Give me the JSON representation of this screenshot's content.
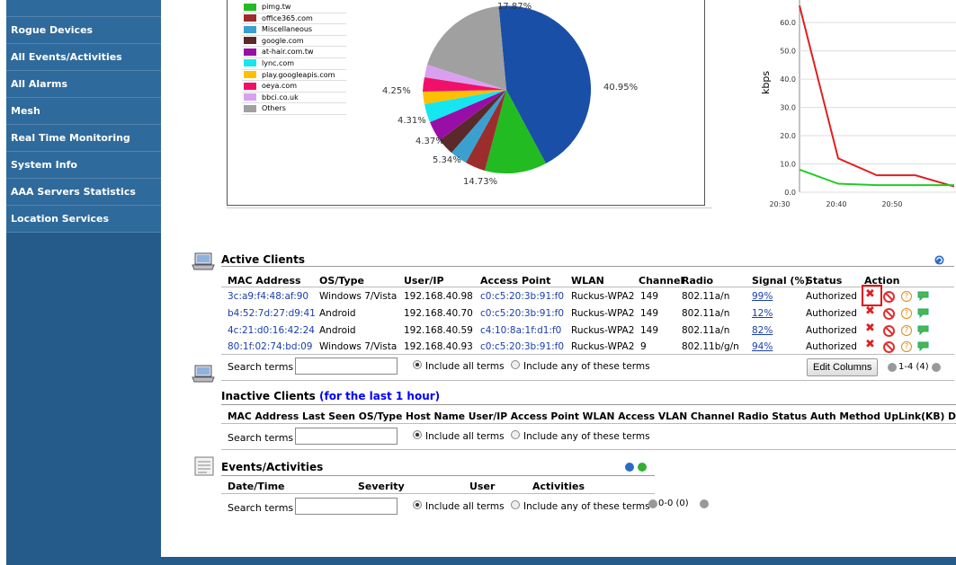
{
  "sidebar": {
    "items": [
      {
        "label": "Rogue Devices"
      },
      {
        "label": "All Events/Activities"
      },
      {
        "label": "All Alarms"
      },
      {
        "label": "Mesh"
      },
      {
        "label": "Real Time Monitoring"
      },
      {
        "label": "System Info"
      },
      {
        "label": "AAA Servers Statistics"
      },
      {
        "label": "Location Services"
      }
    ]
  },
  "pie": {
    "legend": [
      {
        "label": "pimg.tw",
        "color": "#22bb22"
      },
      {
        "label": "office365.com",
        "color": "#9b2d2d"
      },
      {
        "label": "Miscellaneous",
        "color": "#3aa0d0"
      },
      {
        "label": "google.com",
        "color": "#5a2a2a"
      },
      {
        "label": "at-hair.com.tw",
        "color": "#9a0ea8"
      },
      {
        "label": "lync.com",
        "color": "#15e6f0"
      },
      {
        "label": "play.googleapis.com",
        "color": "#ffc000"
      },
      {
        "label": "oeya.com",
        "color": "#f0106a"
      },
      {
        "label": "bbci.co.uk",
        "color": "#d9a0f0"
      },
      {
        "label": "Others",
        "color": "#a0a0a0"
      }
    ],
    "labels": {
      "top": "17.87%",
      "big": "40.95%",
      "green": "14.73%",
      "p534": "5.34%",
      "p437": "4.37%",
      "p431": "4.31%",
      "p425": "4.25%"
    }
  },
  "chart_data": {
    "type": "line",
    "ylabel": "kbps",
    "x": [
      "20:30",
      "20:40",
      "20:50"
    ],
    "yticks": [
      "0.0",
      "10.0",
      "20.0",
      "30.0",
      "40.0",
      "50.0",
      "60.0"
    ],
    "series": [
      {
        "color": "#e02020",
        "points": [
          [
            0,
            66
          ],
          [
            1,
            12
          ],
          [
            2,
            6
          ],
          [
            3,
            6
          ],
          [
            4,
            2
          ]
        ]
      },
      {
        "color": "#22cc22",
        "points": [
          [
            0,
            8
          ],
          [
            1,
            3
          ],
          [
            2,
            2.5
          ],
          [
            3,
            2.5
          ],
          [
            4,
            2.5
          ]
        ]
      }
    ]
  },
  "active": {
    "title": "Active Clients",
    "headers": [
      "MAC Address",
      "OS/Type",
      "User/IP",
      "Access Point",
      "WLAN",
      "Channel",
      "Radio",
      "Signal (%)",
      "Status",
      "Action"
    ],
    "rows": [
      {
        "mac": "3c:a9:f4:48:af:90",
        "os": "Windows 7/Vista",
        "ip": "192.168.40.98",
        "ap": "c0:c5:20:3b:91:f0",
        "wlan": "Ruckus-WPA2",
        "channel": "149",
        "radio": "802.11a/n",
        "signal": "99%",
        "status": "Authorized"
      },
      {
        "mac": "b4:52:7d:27:d9:41",
        "os": "Android",
        "ip": "192.168.40.70",
        "ap": "c0:c5:20:3b:91:f0",
        "wlan": "Ruckus-WPA2",
        "channel": "149",
        "radio": "802.11a/n",
        "signal": "12%",
        "status": "Authorized"
      },
      {
        "mac": "4c:21:d0:16:42:24",
        "os": "Android",
        "ip": "192.168.40.59",
        "ap": "c4:10:8a:1f:d1:f0",
        "wlan": "Ruckus-WPA2",
        "channel": "149",
        "radio": "802.11a/n",
        "signal": "82%",
        "status": "Authorized"
      },
      {
        "mac": "80:1f:02:74:bd:09",
        "os": "Windows 7/Vista",
        "ip": "192.168.40.93",
        "ap": "c0:c5:20:3b:91:f0",
        "wlan": "Ruckus-WPA2",
        "channel": "9",
        "radio": "802.11b/g/n",
        "signal": "94%",
        "status": "Authorized"
      }
    ],
    "search_label": "Search terms",
    "opt_all": "Include all terms",
    "opt_any": "Include any of these terms",
    "edit_columns": "Edit Columns",
    "pager": "1-4 (4)"
  },
  "inactive": {
    "title": "Inactive Clients",
    "subtitle": "(for the last 1 hour)",
    "headers": "MAC Address Last Seen OS/Type Host Name User/IP Access Point WLAN Access VLAN Channel Radio Status Auth Method UpLink(KB) Down",
    "search_label": "Search terms",
    "opt_all": "Include all terms",
    "opt_any": "Include any of these terms"
  },
  "events": {
    "title": "Events/Activities",
    "headers": [
      "Date/Time",
      "Severity",
      "User",
      "Activities"
    ],
    "search_label": "Search terms",
    "opt_all": "Include all terms",
    "opt_any": "Include any of these terms",
    "pager": "0-0 (0)"
  }
}
